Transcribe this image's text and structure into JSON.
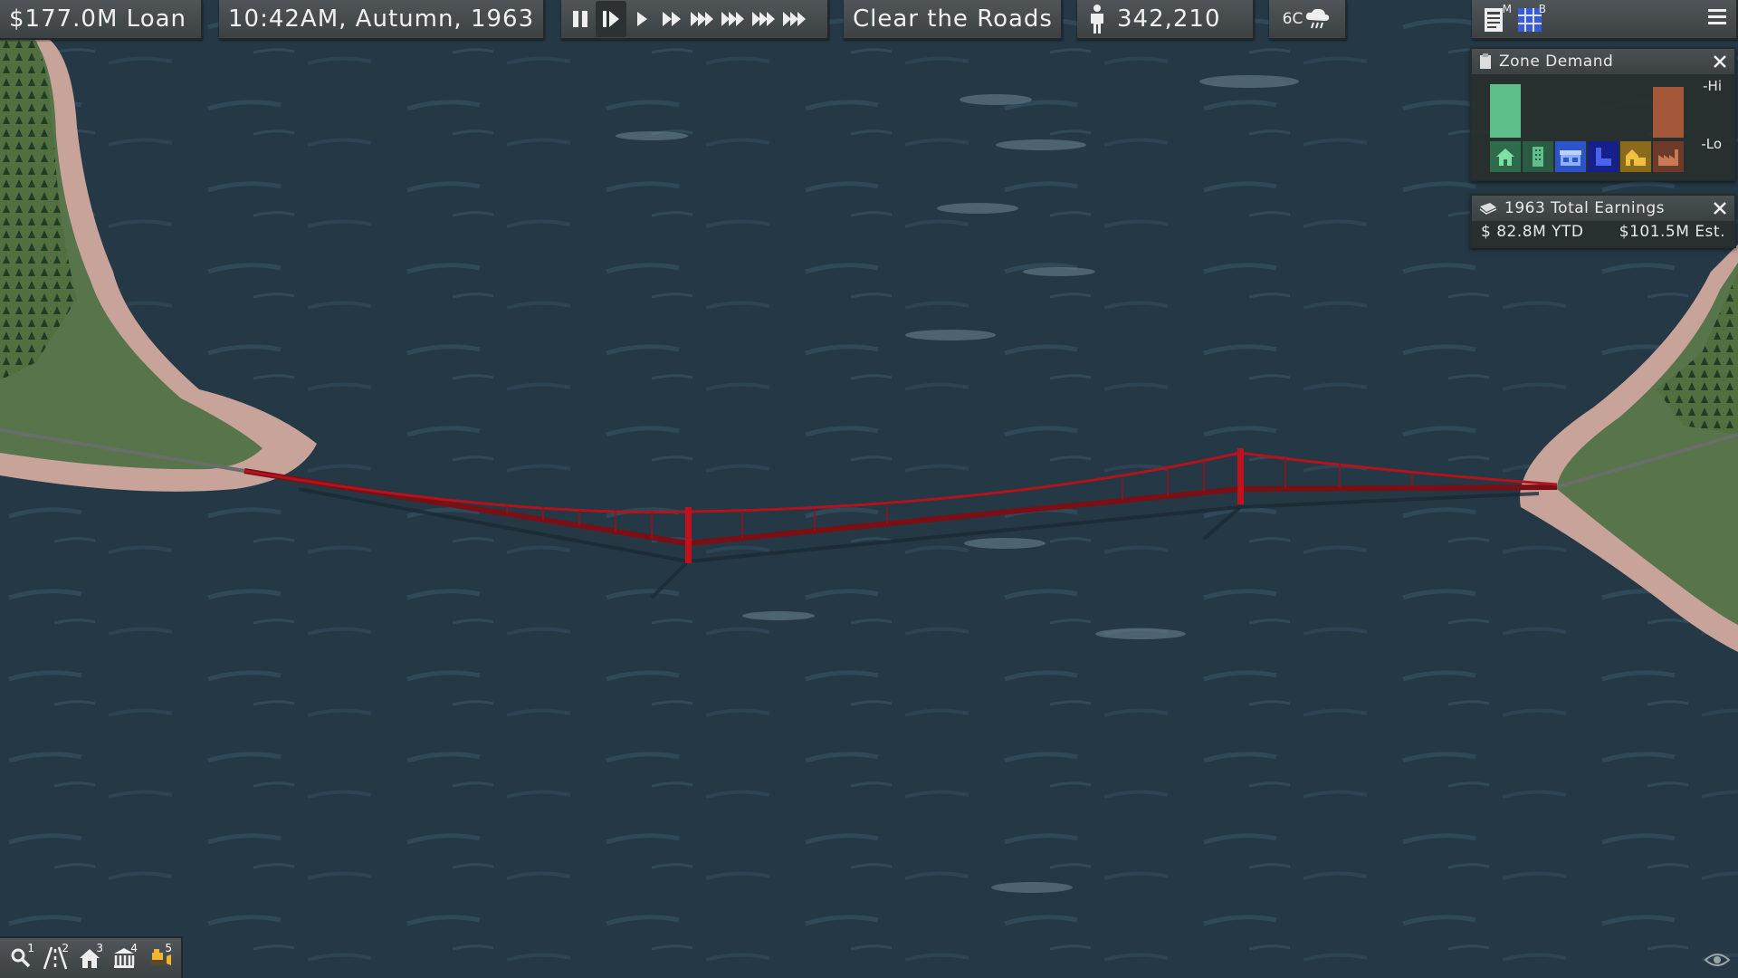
{
  "top_bar": {
    "loan_label": "$177.0M Loan",
    "datetime_label": "10:42AM,  Autumn,  1963",
    "goal_label": "Clear the Roads",
    "population": "342,210",
    "temperature": "6C",
    "speed_controls": [
      "pause",
      "step",
      "play",
      "fast-2",
      "fast-3",
      "fast-4",
      "fast-5",
      "fast-6"
    ],
    "active_speed": "step"
  },
  "top_right": {
    "menu_icon": "hamburger-icon",
    "map_tool_key": "M",
    "budget_tool_key": "B"
  },
  "zone_demand": {
    "title": "Zone Demand",
    "hi_label": "-Hi",
    "lo_label": "-Lo",
    "bars": [
      {
        "zone": "residential-low",
        "level": 0.95,
        "color": "#5fbf8a"
      },
      {
        "zone": "residential-high",
        "level": 0.0,
        "color": "#3c9a6e"
      },
      {
        "zone": "commercial-low",
        "level": 0.0,
        "color": "#3d6fe0"
      },
      {
        "zone": "commercial-high",
        "level": 0.0,
        "color": "#1c2ca8"
      },
      {
        "zone": "industrial-low",
        "level": 0.0,
        "color": "#d9a92a"
      },
      {
        "zone": "industrial-high",
        "level": 0.9,
        "color": "#a3583a"
      }
    ]
  },
  "earnings": {
    "title": "1963 Total Earnings",
    "ytd": "$ 82.8M YTD",
    "estimate": "$101.5M Est."
  },
  "bottom_tools": {
    "items": [
      {
        "icon": "magnifier-icon",
        "key": "1"
      },
      {
        "icon": "road-icon",
        "key": "2"
      },
      {
        "icon": "house-icon",
        "key": "3"
      },
      {
        "icon": "civic-building-icon",
        "key": "4"
      },
      {
        "icon": "bulldozer-icon",
        "key": "5"
      }
    ]
  },
  "colors": {
    "water": "#243845",
    "land": "#57744a",
    "beach": "#c7a39a",
    "bridge": "#a3111a"
  }
}
